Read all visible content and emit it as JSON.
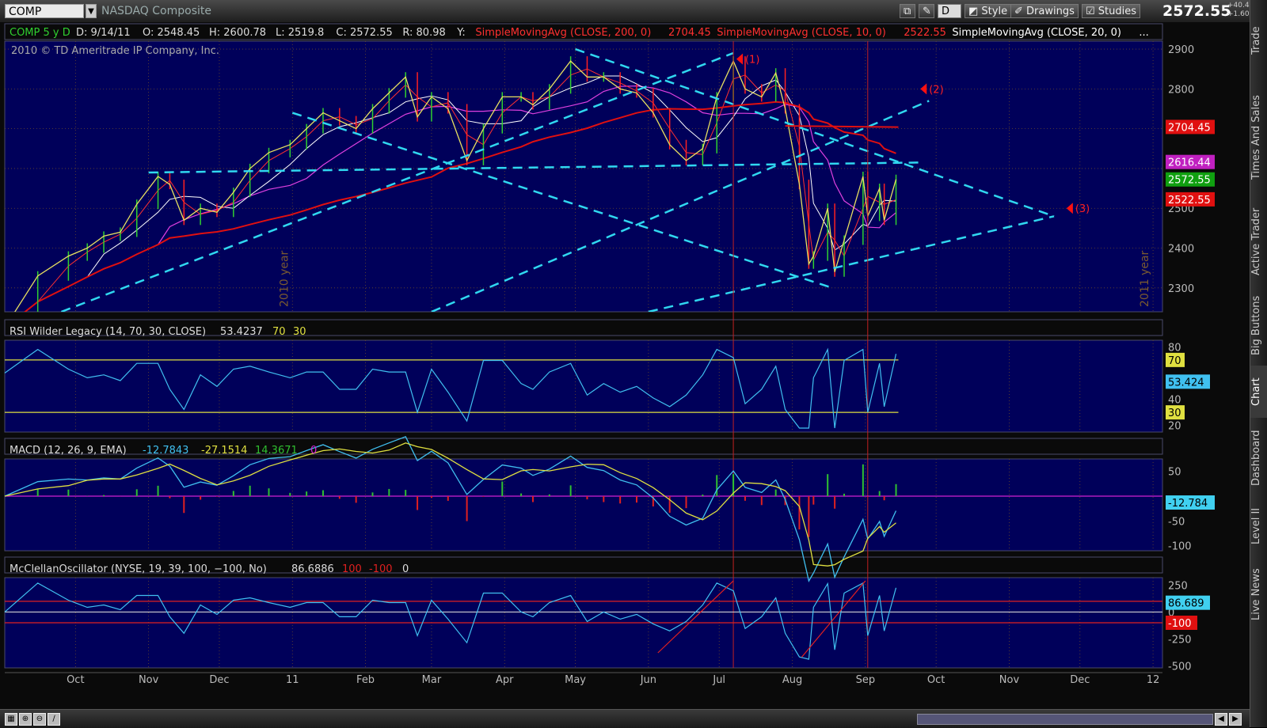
{
  "toolbar": {
    "symbol": "COMP",
    "name": "NASDAQ Composite",
    "period": "D",
    "style": "Style",
    "drawings": "Drawings",
    "studies": "Studies",
    "last": "2572.55",
    "change_abs": "+40.46",
    "change_pct": "+1.60%"
  },
  "side_tabs": [
    "Trade",
    "Times And Sales",
    "Active Trader",
    "Big Buttons",
    "Chart",
    "Dashboard",
    "Level II",
    "Live News"
  ],
  "chart_data": {
    "type": "line",
    "price_panel": {
      "info": {
        "sym": "COMP 5 y D",
        "date": "D: 9/14/11",
        "open": "O: 2548.45",
        "high": "H: 2600.78",
        "low": "L: 2519.8",
        "close": "C: 2572.55",
        "range": "R: 80.98",
        "y": "Y:",
        "sma200_label": "SimpleMovingAvg (CLOSE, 200, 0)",
        "sma200_val": "2704.45",
        "sma10_label": "SimpleMovingAvg (CLOSE, 10, 0)",
        "sma10_val": "2522.55",
        "sma20_label": "SimpleMovingAvg (CLOSE, 20, 0)",
        "more": "...",
        "copyright": "2010 © TD Ameritrade IP Company, Inc."
      },
      "ylim": [
        2240,
        2920
      ],
      "yticks": [
        2300,
        2400,
        2500,
        2800,
        2900
      ],
      "close_series": [
        [
          "2010-09-01",
          2200
        ],
        [
          "2010-09-15",
          2330
        ],
        [
          "2010-09-28",
          2380
        ],
        [
          "2010-10-06",
          2400
        ],
        [
          "2010-10-13",
          2430
        ],
        [
          "2010-10-20",
          2440
        ],
        [
          "2010-10-27",
          2510
        ],
        [
          "2010-11-05",
          2580
        ],
        [
          "2010-11-10",
          2560
        ],
        [
          "2010-11-16",
          2470
        ],
        [
          "2010-11-23",
          2500
        ],
        [
          "2010-11-30",
          2490
        ],
        [
          "2010-12-07",
          2540
        ],
        [
          "2010-12-14",
          2600
        ],
        [
          "2010-12-22",
          2640
        ],
        [
          "2010-12-31",
          2660
        ],
        [
          "2011-01-07",
          2700
        ],
        [
          "2011-01-14",
          2740
        ],
        [
          "2011-01-21",
          2720
        ],
        [
          "2011-01-28",
          2700
        ],
        [
          "2011-02-04",
          2750
        ],
        [
          "2011-02-11",
          2790
        ],
        [
          "2011-02-18",
          2830
        ],
        [
          "2011-02-23",
          2730
        ],
        [
          "2011-03-01",
          2780
        ],
        [
          "2011-03-08",
          2750
        ],
        [
          "2011-03-16",
          2620
        ],
        [
          "2011-03-23",
          2700
        ],
        [
          "2011-03-31",
          2780
        ],
        [
          "2011-04-08",
          2780
        ],
        [
          "2011-04-13",
          2760
        ],
        [
          "2011-04-20",
          2800
        ],
        [
          "2011-04-29",
          2870
        ],
        [
          "2011-05-06",
          2830
        ],
        [
          "2011-05-13",
          2830
        ],
        [
          "2011-05-20",
          2800
        ],
        [
          "2011-05-27",
          2790
        ],
        [
          "2011-06-03",
          2740
        ],
        [
          "2011-06-10",
          2660
        ],
        [
          "2011-06-17",
          2620
        ],
        [
          "2011-06-24",
          2650
        ],
        [
          "2011-06-30",
          2780
        ],
        [
          "2011-07-07",
          2870
        ],
        [
          "2011-07-12",
          2800
        ],
        [
          "2011-07-19",
          2780
        ],
        [
          "2011-07-25",
          2840
        ],
        [
          "2011-07-29",
          2750
        ],
        [
          "2011-08-04",
          2560
        ],
        [
          "2011-08-08",
          2360
        ],
        [
          "2011-08-10",
          2380
        ],
        [
          "2011-08-16",
          2500
        ],
        [
          "2011-08-19",
          2340
        ],
        [
          "2011-08-23",
          2420
        ],
        [
          "2011-08-31",
          2580
        ],
        [
          "2011-09-02",
          2480
        ],
        [
          "2011-09-07",
          2550
        ],
        [
          "2011-09-09",
          2470
        ],
        [
          "2011-09-14",
          2572.55
        ]
      ],
      "last_labels": [
        {
          "text": "2704.45",
          "value": 2704.45,
          "color": "#e01010"
        },
        {
          "text": "2616.44",
          "value": 2616.44,
          "color": "#c020c0"
        },
        {
          "text": "2572.55",
          "value": 2572.55,
          "color": "#10a010"
        },
        {
          "text": "2522.55",
          "value": 2522.55,
          "color": "#e01010"
        }
      ],
      "annotations": [
        "(1)",
        "(2)",
        "(3)",
        "2010 year",
        "2011 year"
      ]
    },
    "rsi_panel": {
      "label": "RSI Wilder Legacy (14, 70, 30, CLOSE)",
      "value": "53.4237",
      "ob": "70",
      "os": "30",
      "last": "53.424",
      "ylim": [
        15,
        85
      ],
      "yticks": [
        80,
        40,
        20
      ]
    },
    "macd_panel": {
      "label": "MACD (12, 26, 9, EMA)",
      "v1": "-12.7843",
      "v2": "-27.1514",
      "v3": "14.3671",
      "v4": "0",
      "last": "-12.784",
      "ylim": [
        -110,
        75
      ],
      "yticks": [
        50,
        -50,
        -100
      ]
    },
    "mcc_panel": {
      "label": "McClellanOscillator (NYSE, 19, 39, 100, −100, No)",
      "value": "86.6886",
      "p100": "100",
      "m100": "-100",
      "zero": "0",
      "last": "86.689",
      "lastm": "-100",
      "ylim": [
        -520,
        320
      ],
      "yticks": [
        250,
        0,
        -250,
        -500
      ]
    },
    "x_ticks": [
      [
        "Oct",
        "2010-10-01"
      ],
      [
        "Nov",
        "2010-11-01"
      ],
      [
        "Dec",
        "2010-12-01"
      ],
      [
        "11",
        "2011-01-01"
      ],
      [
        "Feb",
        "2011-02-01"
      ],
      [
        "Mar",
        "2011-03-01"
      ],
      [
        "Apr",
        "2011-04-01"
      ],
      [
        "May",
        "2011-05-01"
      ],
      [
        "Jun",
        "2011-06-01"
      ],
      [
        "Jul",
        "2011-07-01"
      ],
      [
        "Aug",
        "2011-08-01"
      ],
      [
        "Sep",
        "2011-09-01"
      ],
      [
        "Oct",
        "2011-10-01"
      ],
      [
        "Nov",
        "2011-11-01"
      ],
      [
        "Dec",
        "2011-12-01"
      ],
      [
        "12",
        "2012-01-01"
      ]
    ]
  }
}
